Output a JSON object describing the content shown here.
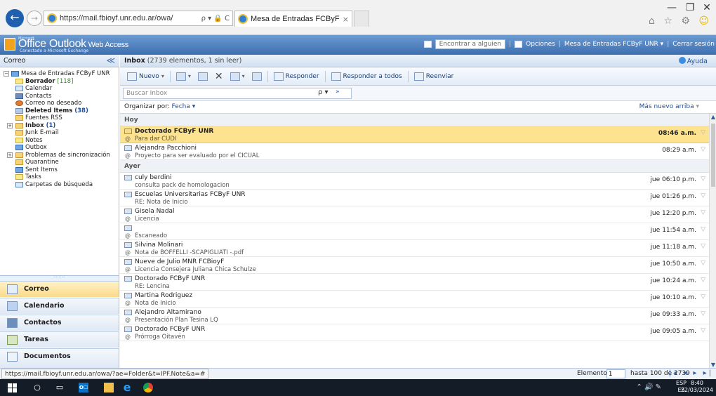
{
  "browser": {
    "url": "https://mail.fbioyf.unr.edu.ar/owa/",
    "url_controls": "ρ ▾ 🔒 C",
    "tab_title": "Mesa de Entradas FCByF U...",
    "tab_close": "×",
    "minimize": "—",
    "restore": "❐",
    "close": "✕",
    "back": "←",
    "forward": "→",
    "toolbar_icons": "⌂ ☆ ⚙",
    "smiley": "☺"
  },
  "owa_header": {
    "ms_small": "Microsoft",
    "logo_main": "Office Outlook",
    "logo_suffix": " Web Access",
    "subtitle": "Conectado a Microsoft Exchange",
    "find_someone": "Encontrar a alguien",
    "options": "Opciones",
    "mailbox_name": "Mesa de Entradas FCByF UNR ▾",
    "sign_out": "Cerrar sesión",
    "separator": "|"
  },
  "left_nav": {
    "title": "Correo",
    "collapse": "≪",
    "folders": [
      {
        "label": "Mesa de Entradas FCByF UNR",
        "count": "",
        "bold": false
      },
      {
        "label": "Borrador",
        "count": "[118]",
        "bold": true
      },
      {
        "label": "Calendar",
        "count": "",
        "bold": false
      },
      {
        "label": "Contacts",
        "count": "",
        "bold": false
      },
      {
        "label": "Correo no deseado",
        "count": "",
        "bold": false
      },
      {
        "label": "Deleted Items",
        "count": "(38)",
        "bold": true
      },
      {
        "label": "Fuentes RSS",
        "count": "",
        "bold": false
      },
      {
        "label": "Inbox",
        "count": "(1)",
        "bold": true
      },
      {
        "label": "Junk E-mail",
        "count": "",
        "bold": false
      },
      {
        "label": "Notes",
        "count": "",
        "bold": false
      },
      {
        "label": "Outbox",
        "count": "",
        "bold": false
      },
      {
        "label": "Problemas de sincronización",
        "count": "",
        "bold": false
      },
      {
        "label": "Quarantine",
        "count": "",
        "bold": false
      },
      {
        "label": "Sent Items",
        "count": "",
        "bold": false
      },
      {
        "label": "Tasks",
        "count": "",
        "bold": false
      },
      {
        "label": "Carpetas de búsqueda",
        "count": "",
        "bold": false
      }
    ],
    "expander_minus": "−",
    "expander_plus": "+",
    "grip": "·········",
    "nav_buttons": [
      "Correo",
      "Calendario",
      "Contactos",
      "Tareas",
      "Documentos"
    ]
  },
  "inbox_header": {
    "title": "Inbox",
    "count": " (2739 elementos, 1 sin leer)",
    "help": "Ayuda"
  },
  "toolbar": {
    "new": "Nuevo",
    "reply": "Responder",
    "reply_all": "Responder a todos",
    "forward": "Reenviar",
    "delete": "✕",
    "dropdown": "▾"
  },
  "search": {
    "placeholder": "Buscar Inbox",
    "search_icon": "ρ ▾",
    "expand": "»"
  },
  "arrange": {
    "label": "Organizar por: ",
    "value": "Fecha ▾",
    "order": "Más nuevo arriba",
    "order_arrow": " ▾"
  },
  "groups": {
    "today": "Hoy",
    "yesterday": "Ayer"
  },
  "messages_today": [
    {
      "sender": "Doctorado FCByF UNR",
      "subject": "Para dar CUDI",
      "date": "08:46 a.m.",
      "attachment": true,
      "unread": true,
      "selected": true
    },
    {
      "sender": "Alejandra Pacchioni",
      "subject": "Proyecto para ser evaluado por el CICUAL",
      "date": "08:29 a.m.",
      "attachment": true,
      "unread": false,
      "selected": false
    }
  ],
  "messages_yesterday": [
    {
      "sender": "culy berdini",
      "subject": "consulta pack de homologacion",
      "date": "jue 06:10 p.m.",
      "attachment": false,
      "unread": false,
      "selected": false
    },
    {
      "sender": "Escuelas Universitarias FCByF UNR",
      "subject": "RE: Nota de Inicio",
      "date": "jue 01:26 p.m.",
      "attachment": false,
      "unread": false,
      "selected": false
    },
    {
      "sender": "Gisela Nadal",
      "subject": "Licencia",
      "date": "jue 12:20 p.m.",
      "attachment": true,
      "unread": false,
      "selected": false
    },
    {
      "sender": "",
      "subject": "Escaneado",
      "date": "jue 11:54 a.m.",
      "attachment": true,
      "unread": false,
      "selected": false
    },
    {
      "sender": "Silvina Molinari",
      "subject": "Nota de BOFFELLI -SCAPIGLIATI -.pdf",
      "date": "jue 11:18 a.m.",
      "attachment": true,
      "unread": false,
      "selected": false
    },
    {
      "sender": "Nueve de Julio MNR FCBioyF",
      "subject": "Licencia Consejera Juliana Chica Schulze",
      "date": "jue 10:50 a.m.",
      "attachment": true,
      "unread": false,
      "selected": false
    },
    {
      "sender": "Doctorado FCByF UNR",
      "subject": "RE: Lencina",
      "date": "jue 10:24 a.m.",
      "attachment": false,
      "unread": false,
      "selected": false
    },
    {
      "sender": "Martina Rodriguez",
      "subject": "Nota de Inicio",
      "date": "jue 10:10 a.m.",
      "attachment": true,
      "unread": false,
      "selected": false
    },
    {
      "sender": "Alejandro Altamirano",
      "subject": "Presentación Plan Tesina LQ",
      "date": "jue 09:33 a.m.",
      "attachment": true,
      "unread": false,
      "selected": false
    },
    {
      "sender": "Doctorado FCByF UNR",
      "subject": "Prórroga Oitavén",
      "date": "jue 09:05 a.m.",
      "attachment": true,
      "unread": false,
      "selected": false
    }
  ],
  "flag_glyph": "▽",
  "clip_glyph": "@",
  "status": {
    "url": "https://mail.fbioyf.unr.edu.ar/owa/?ae=Folder&t=IPF.Note&a=#",
    "items_label": "Elementos",
    "items_value": "1",
    "range": "hasta 100 de 2739",
    "pager": "|◂ ◂ ▸ ▸|"
  },
  "taskbar": {
    "outlook_label": "O☐",
    "ie_glyph": "e",
    "search_glyph": "○",
    "view_glyph": "▭",
    "tray_icons": "⌃ 🔊 ✎",
    "lang_top": "ESP",
    "lang_bottom": "ES",
    "time": "8:40",
    "date": "22/03/2024"
  },
  "colors": {
    "header_blue": "#3d6fb0",
    "selected_row": "#fde28f",
    "link_blue": "#1d4f9c"
  }
}
